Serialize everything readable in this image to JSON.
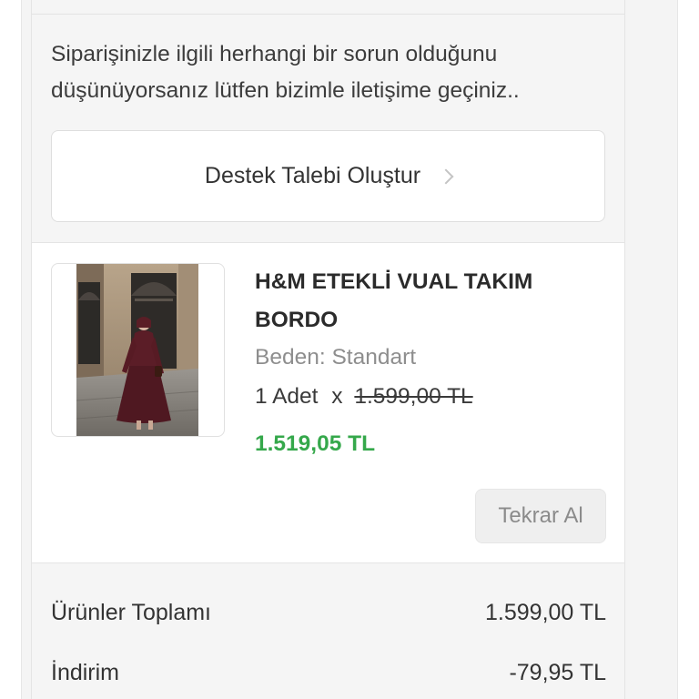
{
  "support": {
    "message": "Siparişinizle ilgili herhangi bir sorun olduğunu düşünüyorsanız lütfen bizimle iletişime geçiniz..",
    "button_label": "Destek Talebi Oluştur"
  },
  "product": {
    "title": "H&M ETEKLİ VUAL TAKIM BORDO",
    "size_text": "Beden: Standart",
    "quantity_text": "1 Adet",
    "multiply_sign": "x",
    "old_price": "1.599,00 TL",
    "new_price": "1.519,05 TL",
    "rebuy_label": "Tekrar Al",
    "image_icon": "product-photo"
  },
  "summary": {
    "rows": [
      {
        "label": "Ürünler Toplamı",
        "value": "1.599,00 TL"
      },
      {
        "label": "İndirim",
        "value": "-79,95 TL"
      }
    ]
  },
  "colors": {
    "discount_price": "#35a84b",
    "page_background": "#f4f4f4",
    "card_background": "#ffffff"
  }
}
